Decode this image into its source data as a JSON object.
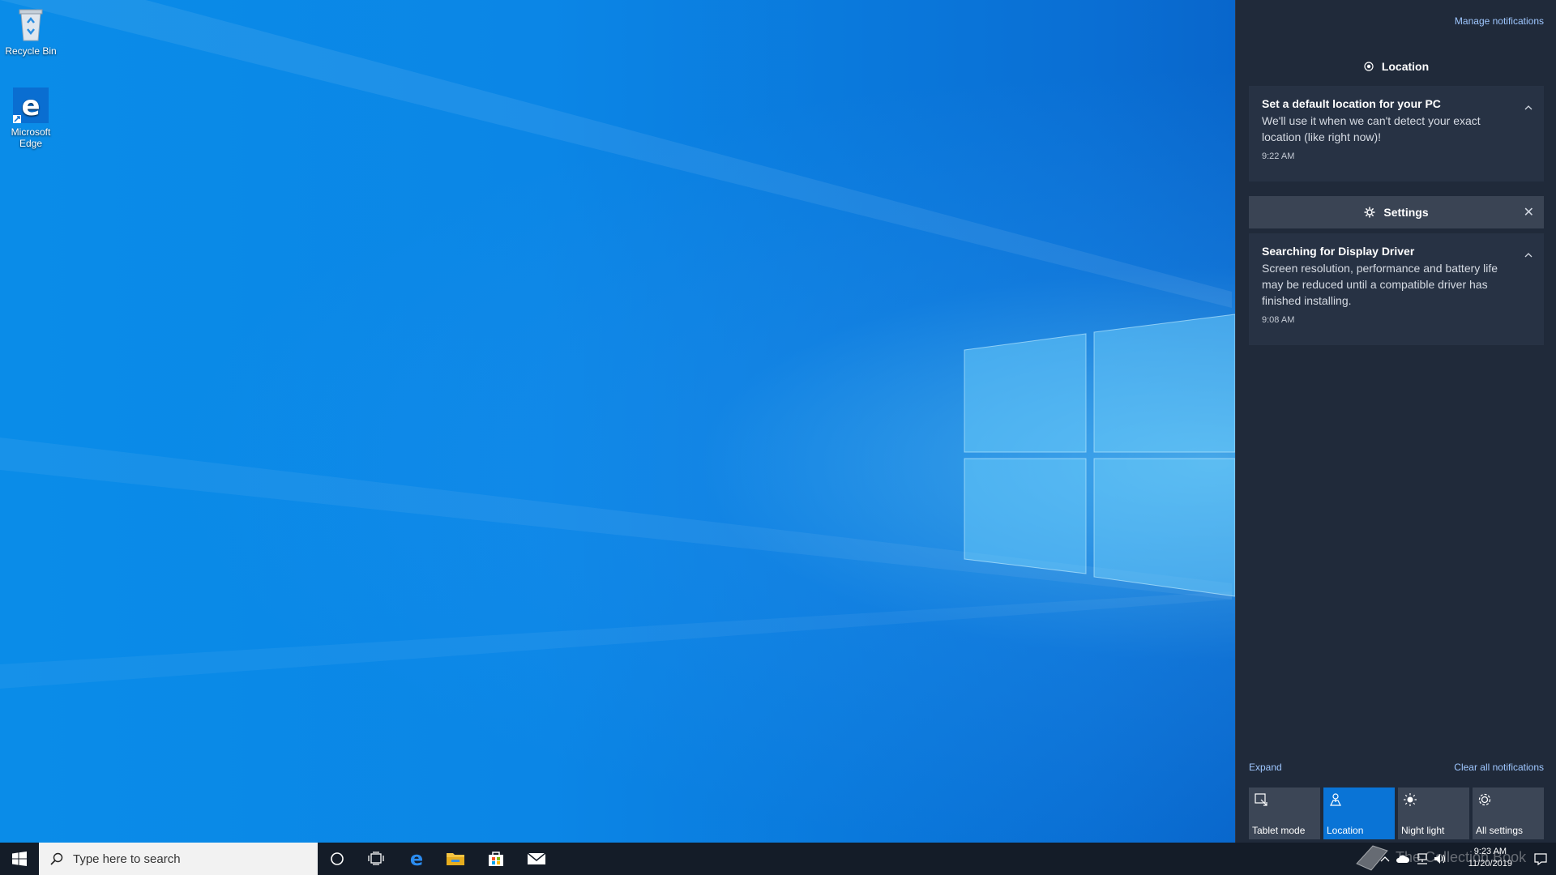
{
  "desktop": {
    "icons": [
      {
        "label": "Recycle Bin"
      },
      {
        "label_line1": "Microsoft",
        "label_line2": "Edge"
      }
    ]
  },
  "action_center": {
    "manage_notifications": "Manage notifications",
    "groups": [
      {
        "app": "Location",
        "icon": "location-dot-icon",
        "notification": {
          "title": "Set a default location for your PC",
          "body": "We'll use it when we can't detect your exact location (like right now)!",
          "time": "9:22 AM"
        }
      },
      {
        "app": "Settings",
        "icon": "gear-icon",
        "notification": {
          "title": "Searching for Display Driver",
          "body": "Screen resolution, performance and battery life may be reduced until a compatible driver has finished installing.",
          "time": "9:08 AM"
        }
      }
    ],
    "expand": "Expand",
    "clear_all": "Clear all notifications",
    "quick_actions": [
      {
        "label": "Tablet mode",
        "icon": "tablet-mode-icon",
        "active": false
      },
      {
        "label": "Location",
        "icon": "location-icon",
        "active": true
      },
      {
        "label": "Night light",
        "icon": "night-light-icon",
        "active": false
      },
      {
        "label": "All settings",
        "icon": "gear-icon",
        "active": false
      }
    ]
  },
  "taskbar": {
    "search_placeholder": "Type here to search",
    "pinned": [
      "cortana-icon",
      "task-view-icon",
      "edge-icon",
      "file-explorer-icon",
      "store-icon",
      "mail-icon"
    ],
    "clock_time": "9:23 AM",
    "clock_date": "11/20/2019"
  },
  "watermark": "The Collection Book",
  "colors": {
    "accent": "#0a74d6",
    "action_center_bg": "#202a3a",
    "toast_bg": "#273244",
    "taskbar_bg": "#141c28"
  }
}
